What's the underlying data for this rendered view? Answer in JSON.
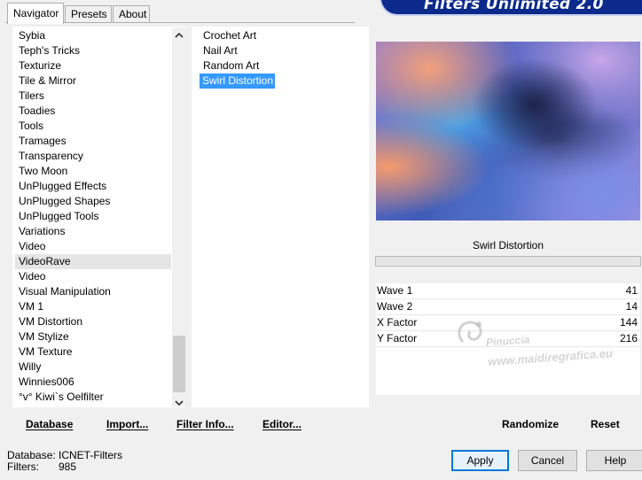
{
  "tabs": [
    {
      "label": "Navigator",
      "active": true
    },
    {
      "label": "Presets",
      "active": false
    },
    {
      "label": "About",
      "active": false
    }
  ],
  "banner_title": "Filters Unlimited 2.0",
  "categories": [
    "Sybia",
    "Teph's Tricks",
    "Texturize",
    "Tile & Mirror",
    "Tilers",
    "Toadies",
    "Tools",
    "Tramages",
    "Transparency",
    "Two Moon",
    "UnPlugged Effects",
    "UnPlugged Shapes",
    "UnPlugged Tools",
    "Variations",
    "Video",
    "VideoRave",
    "Video",
    "Visual Manipulation",
    "VM 1",
    "VM Distortion",
    "VM Stylize",
    "VM Texture",
    "Willy",
    "Winnies006",
    "°v° Kiwi`s Oelfilter"
  ],
  "categories_highlighted_index": 15,
  "filters": [
    "Crochet Art",
    "Nail Art",
    "Random Art",
    "Swirl Distortion"
  ],
  "filters_selected_index": 3,
  "filter_title": "Swirl Distortion",
  "params": [
    {
      "name": "Wave 1",
      "value": "41"
    },
    {
      "name": "Wave 2",
      "value": "14"
    },
    {
      "name": "X Factor",
      "value": "144"
    },
    {
      "name": "Y Factor",
      "value": "216"
    }
  ],
  "watermark": {
    "name": "Pinuccia",
    "url": "www.maidiregrafica.eu"
  },
  "left_toolbar": {
    "database": "Database",
    "import": "Import...",
    "filter_info": "Filter Info...",
    "editor": "Editor..."
  },
  "right_toolbar": {
    "randomize": "Randomize",
    "reset": "Reset"
  },
  "status": {
    "database_label": "Database:",
    "database_value": "ICNET-Filters",
    "filters_label": "Filters:",
    "filters_value": "985"
  },
  "buttons": {
    "apply": "Apply",
    "cancel": "Cancel",
    "help": "Help"
  },
  "colors": {
    "selection": "#3399ff",
    "banner": "#0b2a8c",
    "default_button_border": "#0078d7"
  }
}
